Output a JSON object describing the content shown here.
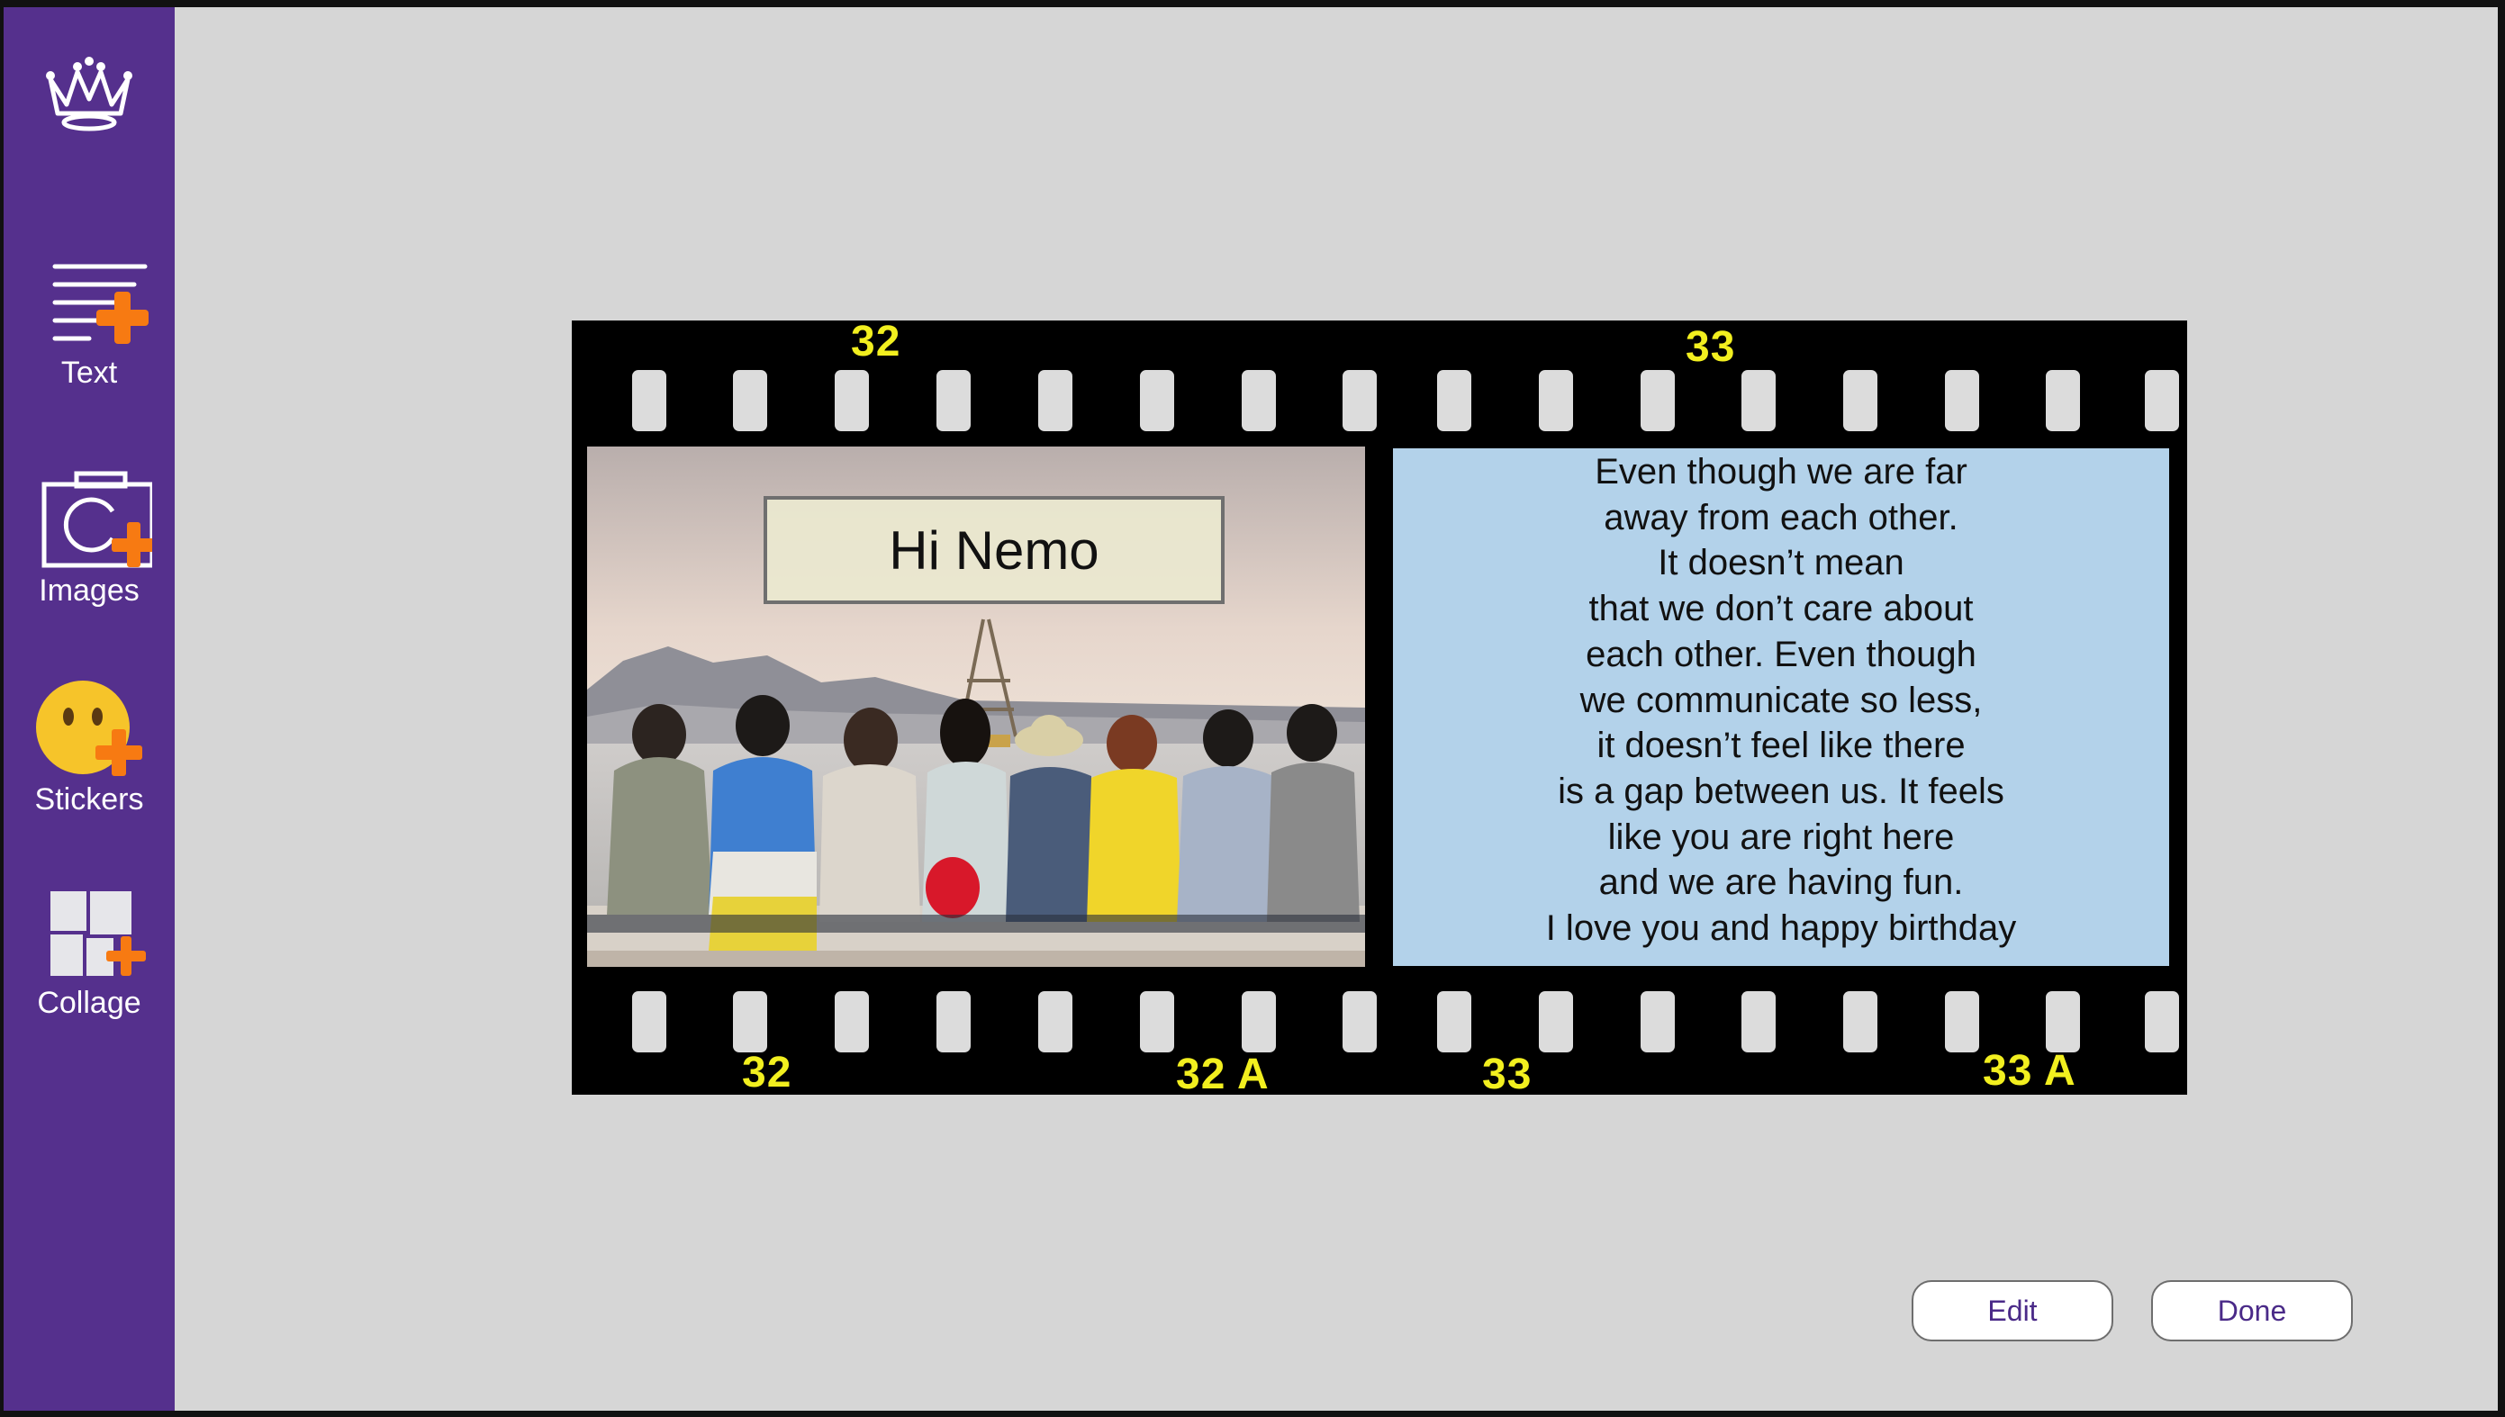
{
  "sidebar": {
    "logo_icon": "crown-icon",
    "items": [
      {
        "label": "Text",
        "icon": "add-text-icon"
      },
      {
        "label": "Images",
        "icon": "add-image-icon"
      },
      {
        "label": "Stickers",
        "icon": "add-sticker-icon"
      },
      {
        "label": "Collage",
        "icon": "add-collage-icon"
      }
    ]
  },
  "card": {
    "frame_numbers_top": [
      "32",
      "33"
    ],
    "frame_numbers_bottom": [
      "32",
      "32 A",
      "33",
      "33 A"
    ],
    "photo_caption": "Hi Nemo",
    "message_lines": [
      "Even though we are far",
      "away from each other.",
      "It doesn’t mean",
      "that we don’t care about",
      "each other. Even though",
      "we communicate so less,",
      "it doesn’t feel like there",
      "is a gap between us. It feels",
      "like you are right here",
      "and we are having fun.",
      "I love you and happy birthday"
    ]
  },
  "actions": {
    "edit_label": "Edit",
    "done_label": "Done"
  },
  "colors": {
    "sidebar": "#55308d",
    "accent_plus": "#f77a12",
    "frame_number": "#f2ef1f",
    "message_bg": "#b3d2ea",
    "workspace_bg": "#d6d6d6",
    "button_text": "#4a2a88"
  }
}
